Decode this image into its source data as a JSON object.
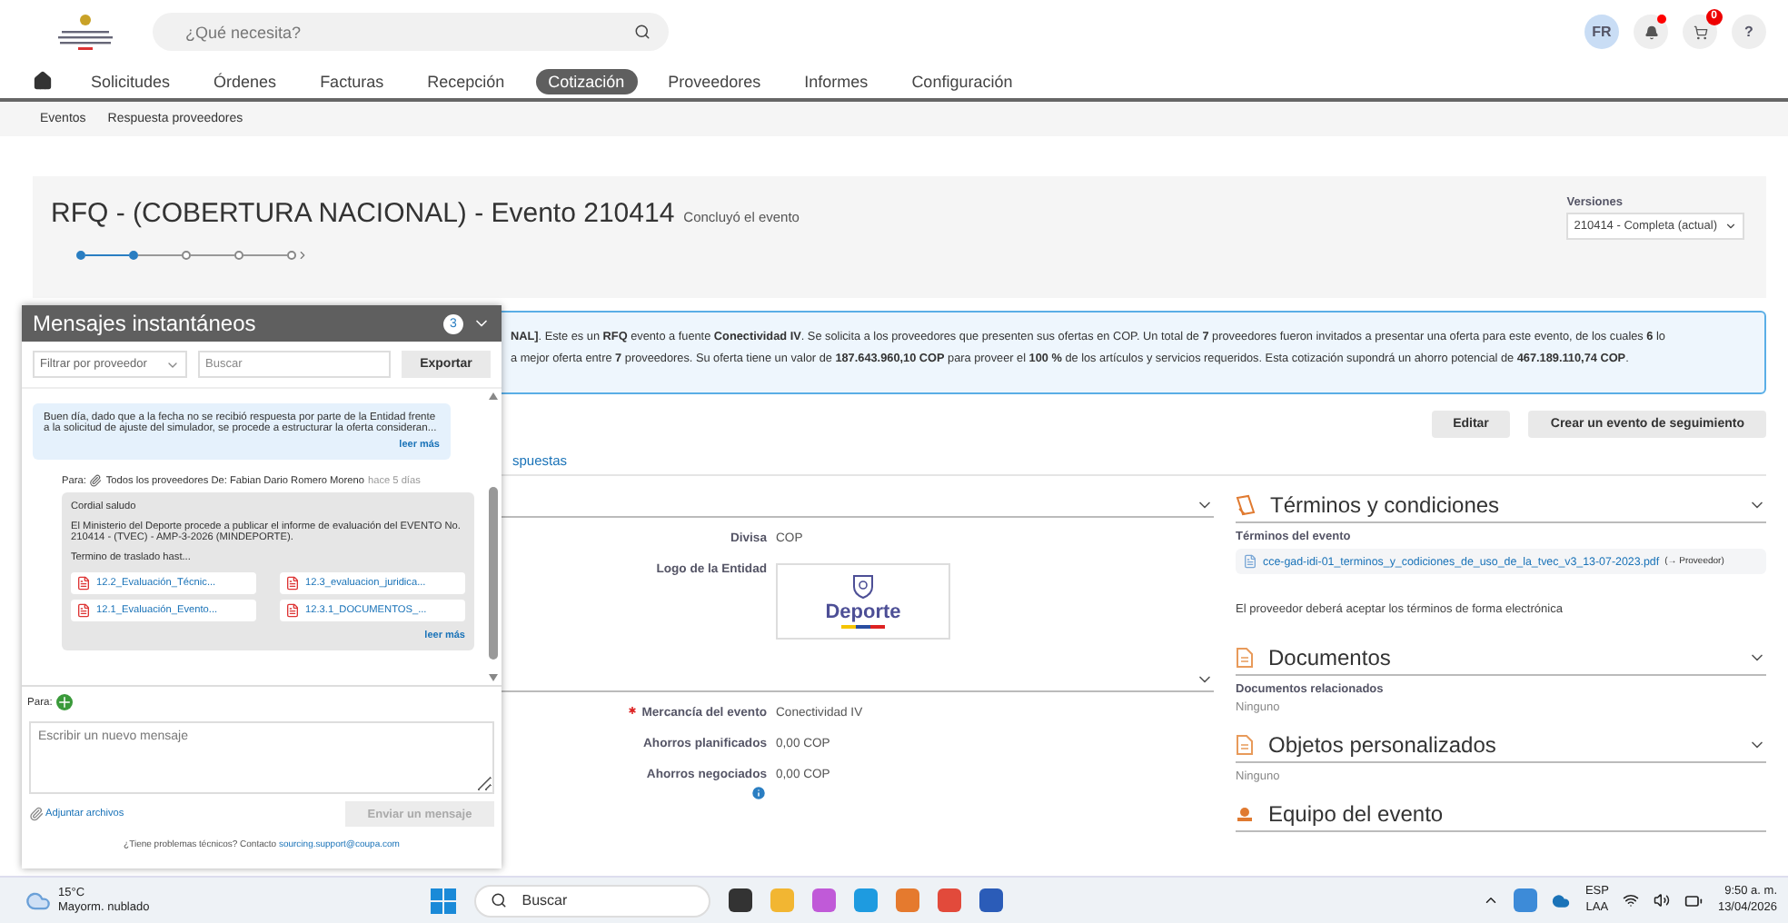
{
  "header": {
    "search_placeholder": "¿Qué necesita?",
    "avatar": "FR",
    "notifications_unread": true,
    "cart_count": "0",
    "help": "?"
  },
  "nav": [
    {
      "label": "Solicitudes",
      "selected": false
    },
    {
      "label": "Órdenes",
      "selected": false
    },
    {
      "label": "Facturas",
      "selected": false
    },
    {
      "label": "Recepción",
      "selected": false
    },
    {
      "label": "Cotización",
      "selected": true
    },
    {
      "label": "Proveedores",
      "selected": false
    },
    {
      "label": "Informes",
      "selected": false
    },
    {
      "label": "Configuración",
      "selected": false
    }
  ],
  "subnav": [
    "Eventos",
    "Respuesta proveedores"
  ],
  "event": {
    "title": "RFQ - (COBERTURA NACIONAL) - Evento 210414",
    "status": "Concluyó el evento",
    "steps": [
      {
        "done": true
      },
      {
        "done": true
      },
      {
        "done": false
      },
      {
        "done": false
      },
      {
        "done": false
      }
    ],
    "versions_label": "Versiones",
    "version": "210414 - Completa (actual)"
  },
  "summary": [
    "**NAL]**. Este es un **RFQ** evento a fuente **Conectividad IV**. Se solicita a los proveedores que presenten sus ofertas en COP. Un total de **7** proveedores fueron invitados a presentar una oferta para este evento, de los cuales **6** lo",
    "a mejor oferta entre **7** proveedores. Su oferta tiene un valor de **187.643.960,10 COP** para proveer el **100 %** de los artículos y servicios requeridos. Esta cotización supondrá un ahorro potencial de **467.189.110,74 COP**."
  ],
  "actions": [
    "Editar",
    "Crear un evento de seguimiento"
  ],
  "tab_link": "spuestas",
  "left_sections": [
    {
      "rows": [
        {
          "kind": "text",
          "label": "Divisa",
          "value": "COP",
          "required": false,
          "info": false
        },
        {
          "kind": "logo",
          "label": "Logo de la Entidad",
          "value": "Deporte"
        }
      ]
    },
    {
      "rows": [
        {
          "kind": "text",
          "label": "Mercancía del evento",
          "value": "Conectividad IV",
          "required": true,
          "info": false
        },
        {
          "kind": "text",
          "label": "Ahorros planificados",
          "value": "0,00 COP",
          "required": false,
          "info": false
        },
        {
          "kind": "text",
          "label": "Ahorros negociados",
          "value": "0,00 COP",
          "required": false,
          "info": true
        }
      ]
    }
  ],
  "right_sections": [
    {
      "kind": "terms",
      "title": "Términos y condiciones",
      "subtitle": "Términos del evento",
      "file": "cce-gad-idi-01_terminos_y_codiciones_de_uso_de_la_tvec_v3_13-07-2023.pdf",
      "file_tag": "(→ Proveedor)",
      "note": "El proveedor deberá aceptar los términos de forma electrónica"
    },
    {
      "kind": "docs",
      "title": "Documentos",
      "subtitle": "Documentos relacionados",
      "value": "Ninguno"
    },
    {
      "kind": "docs",
      "title": "Objetos personalizados",
      "value": "Ninguno"
    },
    {
      "kind": "team",
      "title": "Equipo del evento"
    }
  ],
  "chat": {
    "title": "Mensajes instantáneos",
    "unread": "3",
    "filter_placeholder": "Filtrar por proveedor",
    "search_placeholder": "Buscar",
    "export": "Exportar",
    "messages": [
      {
        "kind": "received",
        "body": "Buen día, dado que a la fecha no se recibió respuesta por parte de la Entidad frente a la solicitud de ajuste del simulador, se procede a estructurar la oferta consideran...",
        "more": "leer más"
      },
      {
        "kind": "sent",
        "to_label": "Para:",
        "recipients": "Todos los proveedores De: Fabian Dario Romero Moreno",
        "time": "hace 5 días",
        "lines": [
          "Cordial saludo",
          "El Ministerio del Deporte procede a publicar el informe de evaluación del EVENTO No. 210414 - (TVEC) - AMP-3-2026 (MINDEPORTE).",
          "Termino de traslado hast..."
        ],
        "attachments": [
          "12.2_Evaluación_Técnic...",
          "12.3_evaluacion_juridica...",
          "12.1_Evaluación_Evento...",
          "12.3.1_DOCUMENTOS_..."
        ],
        "more": "leer más"
      }
    ],
    "to_label": "Para:",
    "compose_placeholder": "Escribir un nuevo mensaje",
    "attach": "Adjuntar archivos",
    "send": "Enviar un mensaje",
    "send_disabled": true,
    "help_text": "¿Tiene problemas técnicos? Contacto",
    "help_link": "sourcing.support@coupa.com"
  },
  "taskbar": {
    "weather_temp": "15°C",
    "weather_desc": "Mayorm. nublado",
    "search": "Buscar",
    "language": "ESP",
    "layout": "LAA",
    "time": "9:50 a. m.",
    "date": "13/04/2026"
  }
}
